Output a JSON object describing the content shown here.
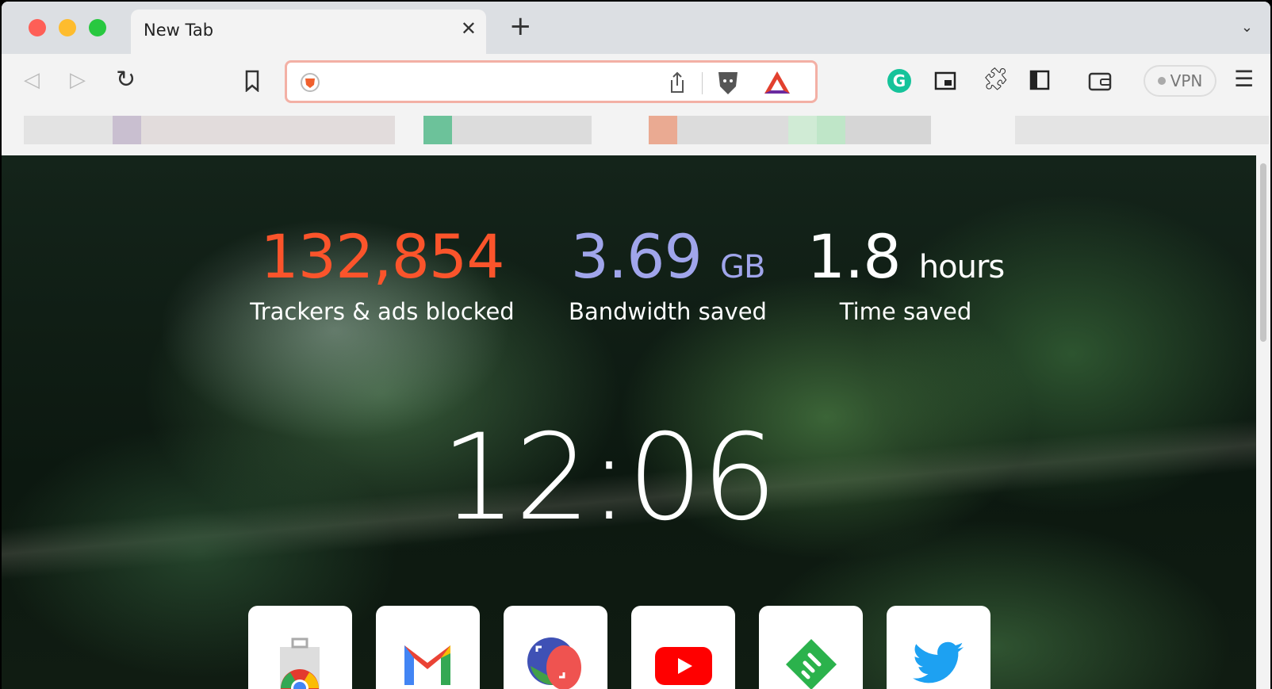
{
  "tab": {
    "title": "New Tab",
    "close": "✕",
    "new_tab": "+"
  },
  "toolbar": {
    "vpn_label": "VPN"
  },
  "stats": [
    {
      "value": "132,854",
      "unit": "",
      "label": "Trackers & ads blocked",
      "color": "#fb542b"
    },
    {
      "value": "3.69",
      "unit": "GB",
      "label": "Bandwidth saved",
      "color": "#a0a5eb"
    },
    {
      "value": "1.8",
      "unit": "hours",
      "label": "Time saved",
      "color": "#ffffff"
    }
  ],
  "clock": "12:06",
  "top_sites": [
    "chrome-web-store",
    "gmail",
    "google-translate-like",
    "youtube",
    "feedly",
    "twitter"
  ]
}
